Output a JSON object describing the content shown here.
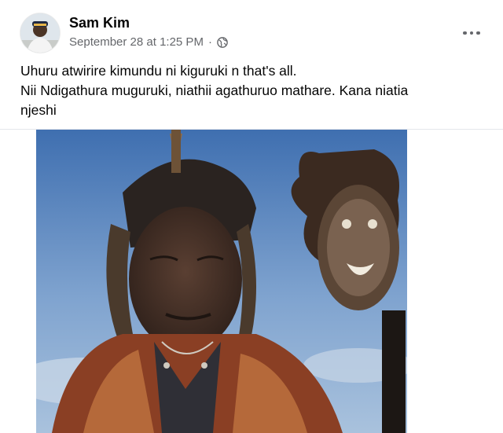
{
  "post": {
    "author_name": "Sam Kim",
    "timestamp": "September 28 at 1:25 PM",
    "separator": "·",
    "privacy_icon": "globe-icon",
    "more_icon": "more-options-icon",
    "text_lines": [
      "Uhuru atwirire kimundu ni kiguruki n that's all.",
      "Nii Ndigathura muguruki,  niathii agathuruo mathare. Kana niatia",
      "njeshi"
    ]
  },
  "colors": {
    "text_primary": "#050505",
    "text_secondary": "#65676b",
    "divider": "#e4e6eb"
  }
}
